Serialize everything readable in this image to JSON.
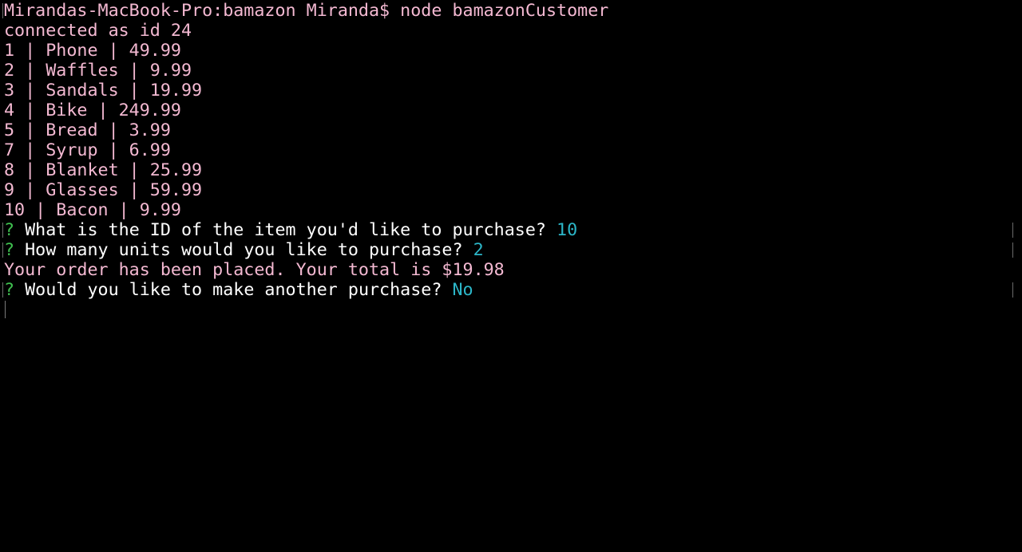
{
  "terminal": {
    "command_prompt": "Mirandas-MacBook-Pro:bamazon Miranda$ ",
    "command": "node bamazonCustomer",
    "connection": "connected as id 24",
    "products": [
      "1 | Phone | 49.99",
      "2 | Waffles | 9.99",
      "3 | Sandals | 19.99",
      "4 | Bike | 249.99",
      "5 | Bread | 3.99",
      "7 | Syrup | 6.99",
      "8 | Blanket | 25.99",
      "9 | Glasses | 59.99",
      "10 | Bacon | 9.99"
    ],
    "prompts": [
      {
        "marker": "?",
        "question": " What is the ID of the item you'd like to purchase? ",
        "answer": "10"
      },
      {
        "marker": "?",
        "question": " How many units would you like to purchase? ",
        "answer": "2"
      }
    ],
    "order_message": "Your order has been placed. Your total is $19.98",
    "final_prompt": {
      "marker": "?",
      "question": " Would you like to make another purchase? ",
      "answer": "No"
    }
  },
  "colors": {
    "background": "#000000",
    "output_text": "#f4b9d2",
    "question_text": "#ffffff",
    "prompt_marker": "#3fbf4f",
    "answer_text": "#2cb6c8"
  }
}
